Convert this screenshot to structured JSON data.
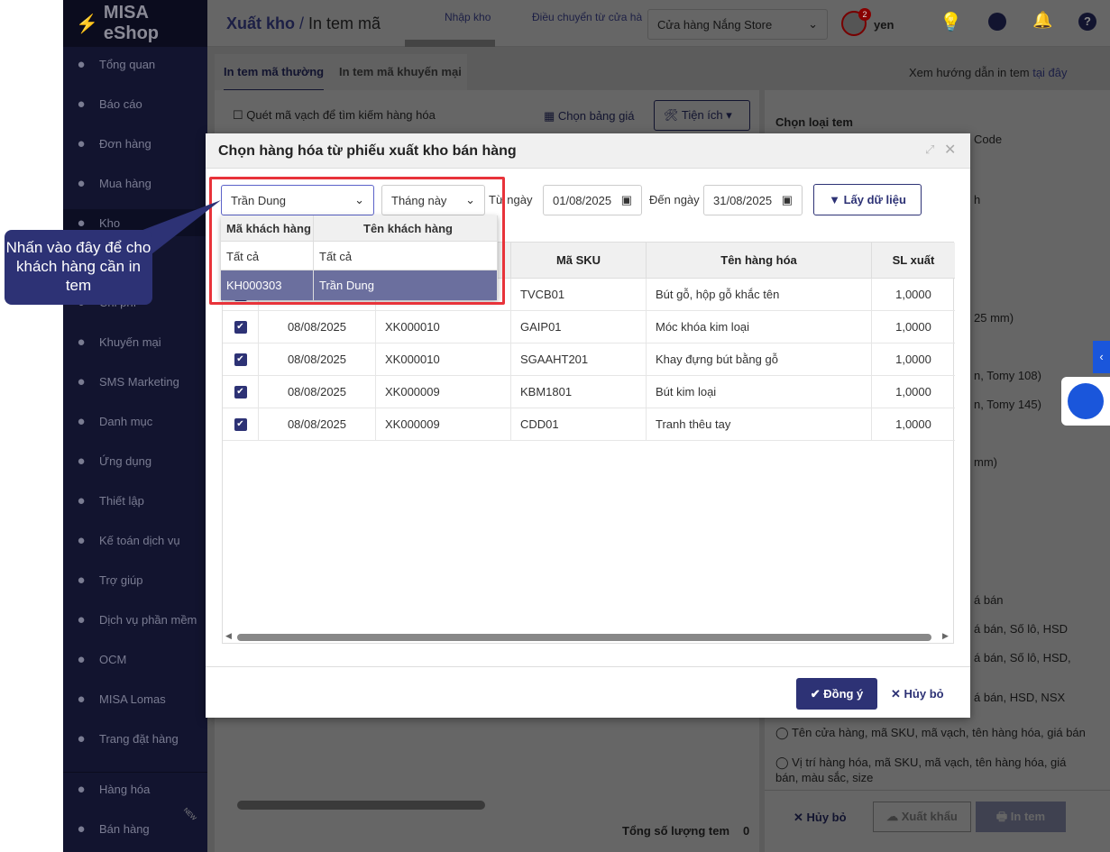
{
  "app": {
    "logo": "MISA eShop"
  },
  "sidebar": {
    "items": [
      {
        "label": "Tổng quan",
        "icon": "dashboard-icon"
      },
      {
        "label": "Báo cáo",
        "icon": "pie-chart-icon"
      },
      {
        "label": "Đơn hàng",
        "icon": "truck-icon"
      },
      {
        "label": "Mua hàng",
        "icon": "cart-icon"
      },
      {
        "label": "Kho",
        "icon": "warehouse-icon"
      },
      {
        "label": "Chi phí",
        "icon": "wallet-icon"
      },
      {
        "label": "Khuyến mại",
        "icon": "gift-icon"
      },
      {
        "label": "SMS Marketing",
        "icon": "phone-icon"
      },
      {
        "label": "Danh mục",
        "icon": "list-icon"
      },
      {
        "label": "Ứng dụng",
        "icon": "apps-icon"
      },
      {
        "label": "Thiết lập",
        "icon": "gear-icon"
      },
      {
        "label": "Kế toán dịch vụ",
        "icon": "accounting-icon"
      },
      {
        "label": "Trợ giúp",
        "icon": "help-icon"
      },
      {
        "label": "Dịch vụ phần mềm",
        "icon": "user-icon"
      },
      {
        "label": "OCM",
        "icon": "ocm-icon"
      },
      {
        "label": "MISA Lomas",
        "icon": "layers-icon"
      },
      {
        "label": "Trang đặt hàng",
        "icon": "basket-icon"
      }
    ],
    "bottom": [
      {
        "label": "Hàng hóa",
        "icon": "boxes-icon"
      },
      {
        "label": "Bán hàng",
        "icon": "sales-icon",
        "badge": "NEW"
      }
    ]
  },
  "topbar": {
    "title_main": "Xuất kho",
    "title_sep": " / ",
    "title_sub": "In tem mã",
    "nav": [
      "Nhập kho",
      "Điều chuyển từ cửa hàng"
    ],
    "store": "Cửa hàng Nắng Store",
    "user": "yen",
    "notif_count": "2"
  },
  "page": {
    "tabs": [
      "In tem mã thường",
      "In tem mã khuyến mại"
    ],
    "guide_text": "Xem hướng dẫn in tem",
    "guide_link": "tại đây",
    "scan_label": "Quét mã vạch để tìm kiếm hàng hóa",
    "price_list": "Chọn bảng giá",
    "utilities": "Tiện ích",
    "total_label": "Tổng số lượng tem",
    "total_value": "0",
    "right": {
      "heading": "Chọn loại tem",
      "fragments": [
        "Code",
        "h",
        "25 mm)",
        "n, Tomy 108)",
        "n, Tomy 145)",
        "mm)",
        "á bán",
        "á bán, Số lô, HSD",
        "á bán, Số lô, HSD,",
        "á bán, HSD, NSX"
      ],
      "options": [
        "Tên cửa hàng, mã SKU, mã vạch, tên hàng hóa, giá bán",
        "Vị trí hàng hóa, mã SKU, mã vạch, tên hàng hóa, giá bán, màu sắc, size"
      ],
      "cancel": "Hủy bỏ",
      "export": "Xuất khẩu",
      "print": "In tem"
    }
  },
  "modal": {
    "title": "Chọn hàng hóa từ phiếu xuất kho bán hàng",
    "customer": "Trần Dung",
    "period": "Tháng này",
    "from_label": "Từ ngày",
    "from": "01/08/2025",
    "to_label": "Đến ngày",
    "to": "31/08/2025",
    "fetch": "Lấy dữ liệu",
    "columns": [
      "Mã SKU",
      "Tên hàng hóa",
      "SL xuất"
    ],
    "rows": [
      {
        "date": "",
        "doc": "",
        "sku": "TVCB01",
        "name": "Bút gỗ, hộp gỗ khắc tên",
        "qty": "1,0000",
        "checked": true
      },
      {
        "date": "08/08/2025",
        "doc": "XK000010",
        "sku": "GAIP01",
        "name": "Móc khóa kim loại",
        "qty": "1,0000",
        "checked": true
      },
      {
        "date": "08/08/2025",
        "doc": "XK000010",
        "sku": "SGAAHT201",
        "name": "Khay đựng bút bằng gỗ",
        "qty": "1,0000",
        "checked": true
      },
      {
        "date": "08/08/2025",
        "doc": "XK000009",
        "sku": "KBM1801",
        "name": "Bút kim loại",
        "qty": "1,0000",
        "checked": true
      },
      {
        "date": "08/08/2025",
        "doc": "XK000009",
        "sku": "CDD01",
        "name": "Tranh thêu tay",
        "qty": "1,0000",
        "checked": true
      }
    ],
    "ok": "Đồng ý",
    "cancel": "Hủy bỏ",
    "dropdown": {
      "headers": [
        "Mã khách hàng",
        "Tên khách hàng"
      ],
      "rows": [
        [
          "Tất cả",
          "Tất cả"
        ],
        [
          "KH000303",
          "Trần Dung"
        ]
      ],
      "selected_index": 1
    }
  },
  "callout": {
    "text": "Nhấn vào đây để cho khách hàng cần in tem"
  },
  "colors": {
    "primary": "#2d3275",
    "highlight": "#6b6f9e",
    "annotation": "#e8333a"
  }
}
